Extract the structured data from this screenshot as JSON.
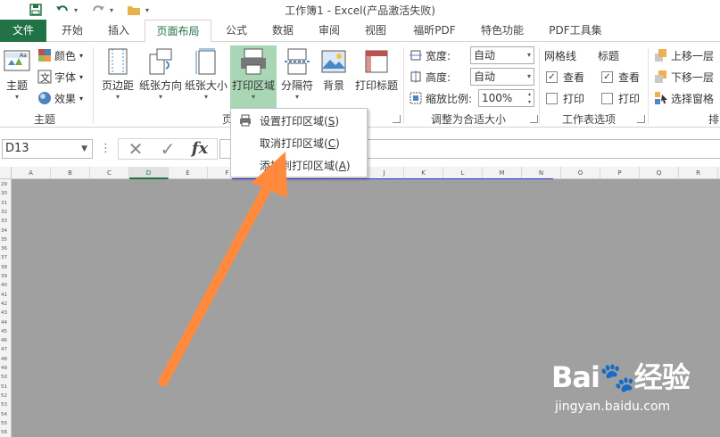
{
  "window": {
    "title": "工作簿1 - Excel(产品激活失败)"
  },
  "qat": {
    "save": "save-icon",
    "undo": "undo-icon",
    "redo": "redo-icon",
    "open": "folder-icon",
    "dropdown": "▾"
  },
  "tabs": [
    {
      "id": "file",
      "label": "文件"
    },
    {
      "id": "home",
      "label": "开始"
    },
    {
      "id": "insert",
      "label": "插入"
    },
    {
      "id": "page-layout",
      "label": "页面布局"
    },
    {
      "id": "formulas",
      "label": "公式"
    },
    {
      "id": "data",
      "label": "数据"
    },
    {
      "id": "review",
      "label": "审阅"
    },
    {
      "id": "view",
      "label": "视图"
    },
    {
      "id": "foxit-pdf",
      "label": "福昕PDF"
    },
    {
      "id": "special",
      "label": "特色功能"
    },
    {
      "id": "pdf-tools",
      "label": "PDF工具集"
    }
  ],
  "ribbon": {
    "theme_group": {
      "label": "主题",
      "theme_btn": "主题",
      "colors": "颜色",
      "fonts": "字体",
      "effects": "效果"
    },
    "page_setup_group": {
      "label": "页",
      "margins": "页边距",
      "orientation": "纸张方向",
      "size": "纸张大小",
      "print_area": "打印区域",
      "breaks": "分隔符",
      "background": "背景",
      "print_titles": "打印标题"
    },
    "scale_group": {
      "label": "调整为合适大小",
      "width_label": "宽度:",
      "width_value": "自动",
      "height_label": "高度:",
      "height_value": "自动",
      "scale_label": "缩放比例:",
      "scale_value": "100%"
    },
    "sheet_options_group": {
      "label": "工作表选项",
      "gridlines": "网格线",
      "headings": "标题",
      "view": "查看",
      "print": "打印"
    },
    "arrange_group": {
      "label": "排",
      "bring_forward": "上移一层",
      "send_backward": "下移一层",
      "selection_pane": "选择窗格"
    }
  },
  "formula_bar": {
    "name_box": "D13",
    "cancel": "✕",
    "enter": "✓",
    "fx": "fx"
  },
  "columns": [
    "A",
    "B",
    "C",
    "D",
    "E",
    "F",
    "G",
    "H",
    "I",
    "J",
    "K",
    "L",
    "M",
    "N",
    "O",
    "P",
    "Q",
    "R"
  ],
  "rows": [
    "29",
    "30",
    "31",
    "32",
    "33",
    "34",
    "35",
    "36",
    "37",
    "38",
    "39",
    "40",
    "41",
    "42",
    "43",
    "44",
    "45",
    "46",
    "47",
    "48",
    "49",
    "50",
    "51",
    "52",
    "53",
    "54",
    "55",
    "56"
  ],
  "print_area_menu": {
    "items": [
      {
        "text": "设置打印区域(",
        "key": "S",
        "end": ")"
      },
      {
        "text": "取消打印区域(",
        "key": "C",
        "end": ")"
      },
      {
        "text": "添加到打印区域(",
        "key": "A",
        "end": ")"
      }
    ]
  },
  "watermark": {
    "logo": "Bai🐾经验",
    "url": "jingyan.baidu.com"
  },
  "colors": {
    "accent": "#217346",
    "highlight": "#a9d6b4",
    "arrow": "#ff8a3d",
    "grid_bg": "#a0a0a0"
  }
}
